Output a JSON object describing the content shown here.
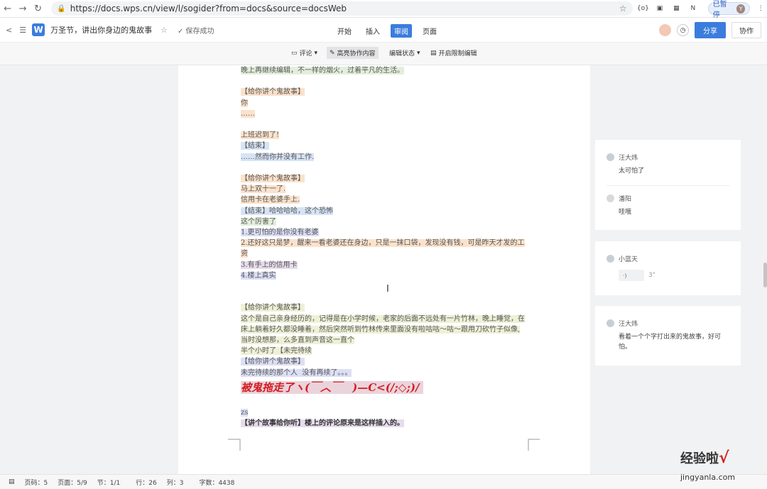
{
  "browser": {
    "url": "https://docs.wps.cn/view/l/sogider?from=docs&source=docsWeb",
    "paused_label": "已暂停",
    "avatar_letter": "Y"
  },
  "app": {
    "doc_title": "万圣节，讲出你身边的鬼故事",
    "saved_status": "保存成功",
    "menu": [
      "开始",
      "插入",
      "审阅",
      "页面"
    ],
    "active_menu": "审阅",
    "share_label": "分享",
    "collab_label": "协作"
  },
  "toolbar": {
    "comment": "评论",
    "highlight": "高亮协作内容",
    "edit_status": "编辑状态",
    "restrict": "开启限制编辑"
  },
  "document": {
    "lines": [
      {
        "text": "晚上再继续编辑，不一样的烟火，过着平凡的生活。",
        "hl": "g"
      },
      {
        "text": "",
        "hl": ""
      },
      {
        "text": "【给你讲个鬼故事】",
        "hl": "o"
      },
      {
        "text": "你",
        "hl": "o"
      },
      {
        "text": "……",
        "hl": "o"
      },
      {
        "text": "",
        "hl": ""
      },
      {
        "text": "上班迟到了!",
        "hl": "o"
      },
      {
        "text": "【结束】",
        "hl": "b"
      },
      {
        "text": "……然而你并没有工作.",
        "hl": "b"
      },
      {
        "text": "",
        "hl": ""
      },
      {
        "text": "【给你讲个鬼故事】",
        "hl": "o"
      },
      {
        "text": "马上双十一了.",
        "hl": "o"
      },
      {
        "text": "信用卡在老婆手上.",
        "hl": "o"
      },
      {
        "text": "【结束】哈哈哈哈，这个恐怖",
        "hl": "b"
      },
      {
        "text": "这个厉害了",
        "hl": "g"
      },
      {
        "text": "1.更可怕的是你没有老婆",
        "hl": "l"
      },
      {
        "text": "2.还好这只是梦，醒来一看老婆还在身边，只是一抹口袋，发现没有钱，可是昨天才发的工",
        "hl": "o"
      },
      {
        "text": "资",
        "hl": "o"
      },
      {
        "text": "3.有手上的信用卡",
        "hl": "p"
      },
      {
        "text": "4.楼上真实",
        "hl": "l"
      },
      {
        "text": "",
        "hl": ""
      },
      {
        "text": "",
        "hl": ""
      },
      {
        "text": "【给你讲个鬼故事】",
        "hl": "y"
      },
      {
        "text": "这个是自己亲身经历的，记得是在小学时候，老家的后面不远处有一片竹林，晚上睡觉，在",
        "hl": "y"
      },
      {
        "text": "床上躺着好久都没睡着，然后突然听到竹林传来里面没有啦咕咕～咕～跟用刀砍竹子似像,",
        "hl": "y"
      },
      {
        "text": "当时没想那，么多直到声音这一直个",
        "hl": "y"
      },
      {
        "text": "半个小时了【未完待续",
        "hl": "y"
      },
      {
        "text": "【给你讲个鬼故事】",
        "hl": "l"
      },
      {
        "text": "未完待续的那个人  没有再续了。。。",
        "hl": "l"
      }
    ],
    "big_line": "被鬼拖走了ヽ(￣︿￣　)—C<(/;◇;)/",
    "tail_lines": [
      {
        "text": "",
        "hl": ""
      },
      {
        "text": "zs",
        "hl": "l"
      },
      {
        "text": "【讲个故事给你听】楼上的评论原来是这样插入的。",
        "hl": "p"
      }
    ]
  },
  "comments": [
    {
      "user": "汪大炜",
      "text": "太可怕了"
    },
    {
      "user": "潘阳",
      "text": "哇哦"
    },
    {
      "user": "小蓝天",
      "text": "",
      "audio": "3\""
    },
    {
      "user": "汪大炜",
      "text": "看着一个个字打出来的鬼故事，好可怕。"
    }
  ],
  "status": {
    "page_code": "页码：5",
    "page": "页面：5/9",
    "section": "节：1/1",
    "row": "行：26",
    "col": "列：3",
    "words": "字数：4438"
  },
  "watermark": {
    "cn": "经验啦",
    "en": "jingyanla.com",
    "check": "√"
  },
  "colors": {
    "accent": "#3b7ddd",
    "highlight_orange": "#fbe2cc",
    "highlight_green": "#e3efdc",
    "highlight_blue": "#d6e4f5",
    "highlight_purple": "#e6dcec",
    "big_text": "#d21d20"
  }
}
